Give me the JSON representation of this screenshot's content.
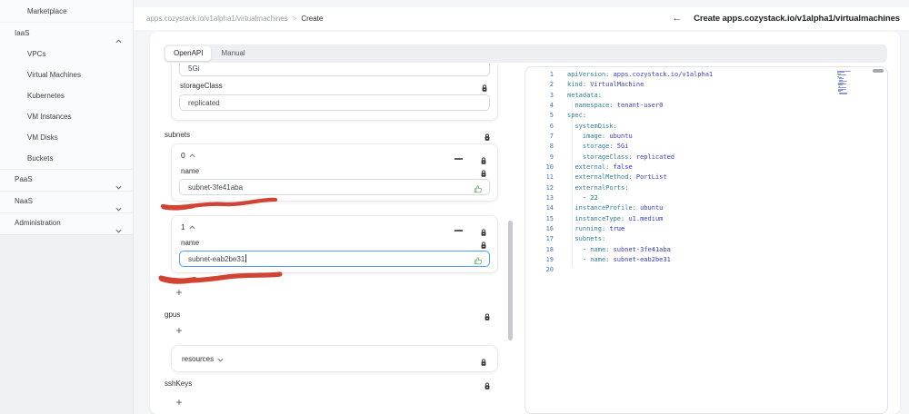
{
  "sidebar": {
    "marketplace_label": "Marketplace",
    "iaas": {
      "label": "IaaS",
      "items": [
        "VPCs",
        "Virtual Machines",
        "Kubernetes",
        "VM Instances",
        "VM Disks",
        "Buckets"
      ]
    },
    "collapsed_sections": [
      "PaaS",
      "NaaS",
      "Administration"
    ]
  },
  "header": {
    "breadcrumb": {
      "path": "apps.cozystack.io/v1alpha1/virtualmachines",
      "separator": ">",
      "current": "Create"
    },
    "back_icon": "←",
    "title": "Create apps.cozystack.io/v1alpha1/virtualmachines"
  },
  "tabs": {
    "active": "OpenAPI",
    "inactive": "Manual"
  },
  "form": {
    "clipped_input_value": "5Gi",
    "storage_class": {
      "label": "storageClass",
      "value": "replicated"
    },
    "subnets": {
      "label": "subnets",
      "items": [
        {
          "index": "0",
          "name_label": "name",
          "value": "subnet-3fe41aba",
          "focused": false
        },
        {
          "index": "1",
          "name_label": "name",
          "value": "subnet-eab2be31",
          "focused": true
        }
      ],
      "add_label": "+"
    },
    "gpus": {
      "label": "gpus",
      "add_label": "+"
    },
    "resources": {
      "label": "resources"
    },
    "ssh_keys": {
      "label": "sshKeys",
      "add_label": "+"
    }
  },
  "editor": {
    "lines": [
      {
        "n": "1",
        "tokens": [
          [
            "apiVersion:",
            "k"
          ],
          [
            " apps.cozystack.io/v1alpha1",
            "v"
          ]
        ]
      },
      {
        "n": "2",
        "tokens": [
          [
            "kind:",
            "k"
          ],
          [
            " VirtualMachine",
            "v"
          ]
        ]
      },
      {
        "n": "3",
        "tokens": [
          [
            "metadata:",
            "k"
          ]
        ]
      },
      {
        "n": "4",
        "tokens": [
          [
            "  ",
            "d"
          ],
          [
            "namespace:",
            "k"
          ],
          [
            " tenant-user0",
            "v"
          ]
        ]
      },
      {
        "n": "5",
        "tokens": [
          [
            "spec:",
            "k"
          ]
        ]
      },
      {
        "n": "6",
        "tokens": [
          [
            "  ",
            "d"
          ],
          [
            "systemDisk:",
            "k"
          ]
        ]
      },
      {
        "n": "7",
        "tokens": [
          [
            "    ",
            "d"
          ],
          [
            "image:",
            "k"
          ],
          [
            " ubuntu",
            "v"
          ]
        ]
      },
      {
        "n": "8",
        "tokens": [
          [
            "    ",
            "d"
          ],
          [
            "storage:",
            "k"
          ],
          [
            " 5Gi",
            "v"
          ]
        ]
      },
      {
        "n": "9",
        "tokens": [
          [
            "    ",
            "d"
          ],
          [
            "storageClass:",
            "k"
          ],
          [
            " replicated",
            "v"
          ]
        ]
      },
      {
        "n": "10",
        "tokens": [
          [
            "  ",
            "d"
          ],
          [
            "external:",
            "k"
          ],
          [
            " false",
            "b"
          ]
        ]
      },
      {
        "n": "11",
        "tokens": [
          [
            "  ",
            "d"
          ],
          [
            "externalMethod:",
            "k"
          ],
          [
            " PortList",
            "v"
          ]
        ]
      },
      {
        "n": "12",
        "tokens": [
          [
            "  ",
            "d"
          ],
          [
            "externalPorts:",
            "k"
          ]
        ]
      },
      {
        "n": "13",
        "tokens": [
          [
            "    ",
            "d"
          ],
          [
            "- ",
            "p"
          ],
          [
            "22",
            "num"
          ]
        ]
      },
      {
        "n": "14",
        "tokens": [
          [
            "  ",
            "d"
          ],
          [
            "instanceProfile:",
            "k"
          ],
          [
            " ubuntu",
            "v"
          ]
        ]
      },
      {
        "n": "15",
        "tokens": [
          [
            "  ",
            "d"
          ],
          [
            "instanceType:",
            "k"
          ],
          [
            " u1.medium",
            "v"
          ]
        ]
      },
      {
        "n": "16",
        "tokens": [
          [
            "  ",
            "d"
          ],
          [
            "running:",
            "k"
          ],
          [
            " true",
            "b"
          ]
        ]
      },
      {
        "n": "17",
        "tokens": [
          [
            "  ",
            "d"
          ],
          [
            "subnets:",
            "k"
          ]
        ]
      },
      {
        "n": "18",
        "tokens": [
          [
            "    ",
            "d"
          ],
          [
            "- ",
            "p"
          ],
          [
            "name:",
            "k"
          ],
          [
            " subnet-3fe41aba",
            "v"
          ]
        ]
      },
      {
        "n": "19",
        "tokens": [
          [
            "    ",
            "d"
          ],
          [
            "- ",
            "p"
          ],
          [
            "name:",
            "k"
          ],
          [
            " subnet-eab2be31",
            "v"
          ]
        ]
      },
      {
        "n": "20",
        "tokens": []
      }
    ]
  },
  "colors": {
    "annotation_red": "#cf3a2a",
    "code_key": "#2f7f93",
    "code_value": "#3b41c4",
    "code_bool": "#2028d8",
    "code_number": "#0e8657",
    "focus_blue": "#4f9dfd",
    "thumb_green": "#5fae63",
    "line_number_blue": "#4a76b2"
  }
}
